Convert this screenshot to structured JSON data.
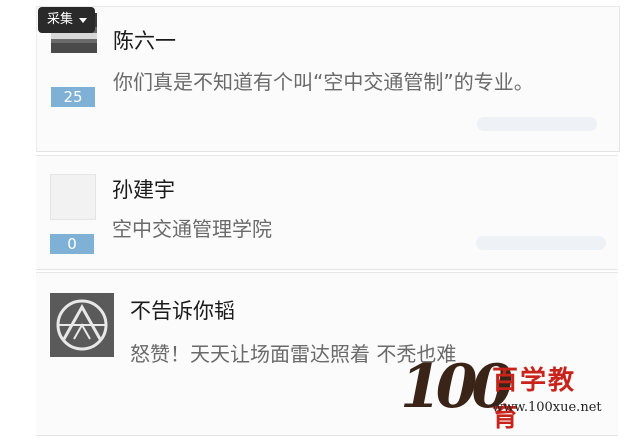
{
  "toolbar": {
    "collect_label": "采集"
  },
  "comments": [
    {
      "name": "陈六一",
      "badge": "25",
      "text": "你们真是不知道有个叫“空中交通管制”的专业。"
    },
    {
      "name": "孙建宇",
      "badge": "0",
      "text": "空中交通管理学院"
    },
    {
      "name": "不告诉你韬",
      "badge": "",
      "text": "怒赞！天天让场面雷达照着 不秃也难"
    }
  ],
  "watermark": {
    "digits": "100",
    "brand": "百学教育",
    "url": "www.100xue.net"
  },
  "colors": {
    "badge": "#7fb0d6",
    "brand_red": "#c8241c",
    "name_text": "#1a1a1a",
    "message_text": "#6a6a6a"
  }
}
